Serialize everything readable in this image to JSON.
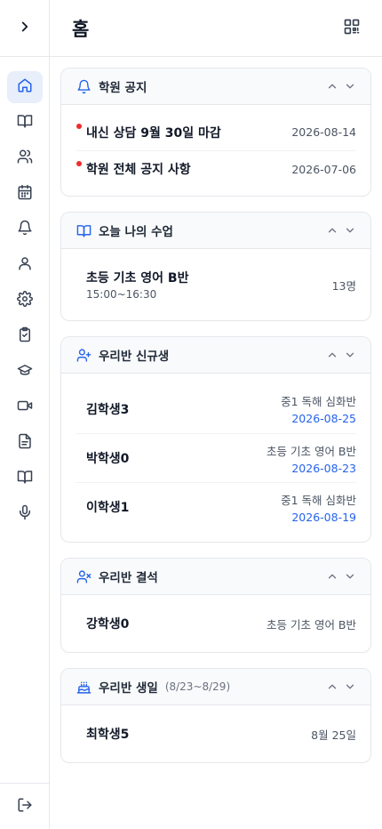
{
  "header": {
    "title": "홈"
  },
  "sidebar": {
    "items": [
      {
        "icon": "home-icon",
        "active": true
      },
      {
        "icon": "book-open-icon"
      },
      {
        "icon": "users-icon"
      },
      {
        "icon": "calendar-icon"
      },
      {
        "icon": "bell-icon"
      },
      {
        "icon": "user-icon"
      },
      {
        "icon": "settings-icon"
      },
      {
        "icon": "clipboard-check-icon"
      },
      {
        "icon": "graduation-cap-icon"
      },
      {
        "icon": "video-icon"
      },
      {
        "icon": "file-text-icon"
      },
      {
        "icon": "book-icon"
      },
      {
        "icon": "mic-icon"
      }
    ]
  },
  "notices": {
    "title": "학원 공지",
    "items": [
      {
        "title": "내신 상담 9월 30일 마감",
        "date": "2026-08-14"
      },
      {
        "title": "학원 전체 공지 사항",
        "date": "2026-07-06"
      }
    ]
  },
  "today_classes": {
    "title": "오늘 나의 수업",
    "items": [
      {
        "name": "초등 기초 영어 B반",
        "time": "15:00~16:30",
        "count": "13명"
      }
    ]
  },
  "new_students": {
    "title": "우리반 신규생",
    "items": [
      {
        "name": "김학생3",
        "class": "중1 독해 심화반",
        "date": "2026-08-25"
      },
      {
        "name": "박학생0",
        "class": "초등 기초 영어 B반",
        "date": "2026-08-23"
      },
      {
        "name": "이학생1",
        "class": "중1 독해 심화반",
        "date": "2026-08-19"
      }
    ]
  },
  "absences": {
    "title": "우리반 결석",
    "items": [
      {
        "name": "강학생0",
        "class": "초등 기초 영어 B반"
      }
    ]
  },
  "birthdays": {
    "title": "우리반 생일",
    "range": "(8/23~8/29)",
    "items": [
      {
        "name": "최학생5",
        "date": "8월 25일"
      }
    ]
  },
  "colors": {
    "accent": "#2563eb",
    "active_bg": "#e8effb",
    "dot": "#ef2b2b"
  }
}
